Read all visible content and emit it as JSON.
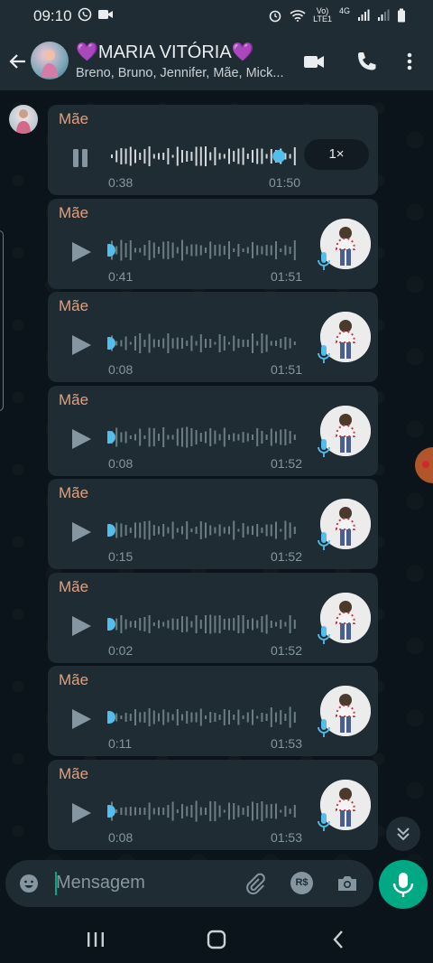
{
  "status_bar": {
    "time": "09:10",
    "network": "4G",
    "network_sub": "LTE1",
    "volte": "Vo)"
  },
  "header": {
    "title": "💜MARIA VITÓRIA💜",
    "subtitle": "Breno, Bruno, Jennifer, Mãe, Mick..."
  },
  "messages": [
    {
      "sender": "Mãe",
      "duration": "0:38",
      "time": "01:50",
      "state": "playing",
      "speed": "1×",
      "progress": 0.97
    },
    {
      "sender": "Mãe",
      "duration": "0:41",
      "time": "01:51",
      "state": "paused",
      "progress": 0
    },
    {
      "sender": "Mãe",
      "duration": "0:08",
      "time": "01:51",
      "state": "paused",
      "progress": 0
    },
    {
      "sender": "Mãe",
      "duration": "0:08",
      "time": "01:52",
      "state": "paused",
      "progress": 0
    },
    {
      "sender": "Mãe",
      "duration": "0:15",
      "time": "01:52",
      "state": "paused",
      "progress": 0
    },
    {
      "sender": "Mãe",
      "duration": "0:02",
      "time": "01:52",
      "state": "paused",
      "progress": 0
    },
    {
      "sender": "Mãe",
      "duration": "0:11",
      "time": "01:53",
      "state": "paused",
      "progress": 0
    },
    {
      "sender": "Mãe",
      "duration": "0:08",
      "time": "01:53",
      "state": "paused",
      "progress": 0
    }
  ],
  "composer": {
    "placeholder": "Mensagem",
    "currency_label": "R$"
  },
  "colors": {
    "accent": "#00a884",
    "sender_name": "#e1a07f",
    "bubble": "#1f2c34",
    "wave_dot": "#53bdeb"
  }
}
